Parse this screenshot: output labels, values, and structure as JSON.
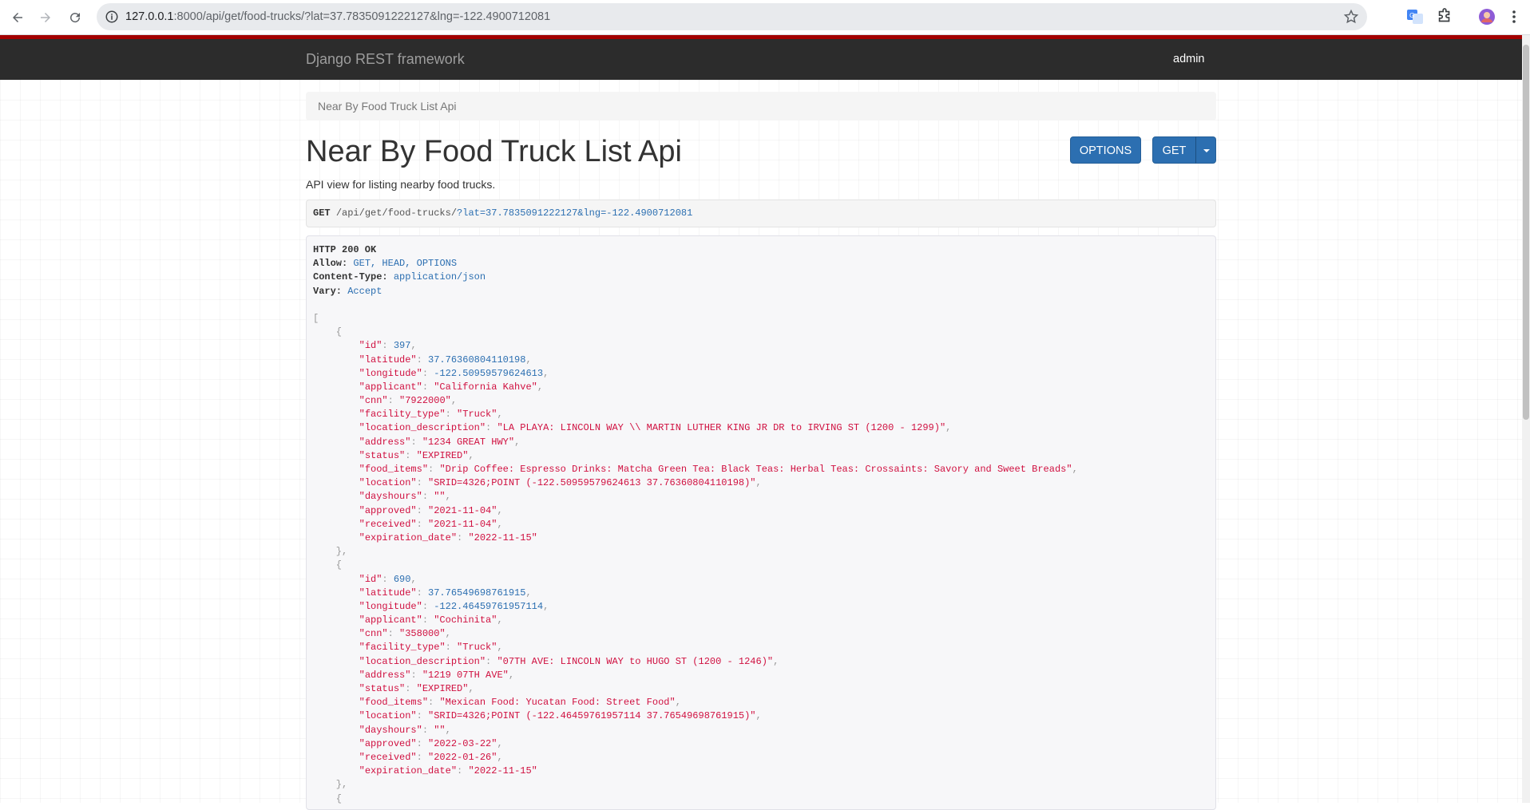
{
  "browser": {
    "url_host": "127.0.0.1",
    "url_rest": ":8000/api/get/food-trucks/?lat=37.7835091222127&lng=-122.4900712081"
  },
  "navbar": {
    "brand": "Django REST framework",
    "user": "admin"
  },
  "breadcrumb": "Near By Food Truck List Api",
  "page": {
    "title": "Near By Food Truck List Api",
    "description": "API view for listing nearby food trucks.",
    "options_label": "OPTIONS",
    "get_label": "GET"
  },
  "request": {
    "method": "GET",
    "path": "/api/get/food-trucks/",
    "query": "?lat=37.7835091222127&lng=-122.4900712081"
  },
  "response": {
    "status": "HTTP 200 OK",
    "headers": [
      {
        "key": "Allow:",
        "value": "GET, HEAD, OPTIONS"
      },
      {
        "key": "Content-Type:",
        "value": "application/json"
      },
      {
        "key": "Vary:",
        "value": "Accept"
      }
    ],
    "records": [
      [
        {
          "k": "id",
          "v": "397",
          "t": "num"
        },
        {
          "k": "latitude",
          "v": "37.76360804110198",
          "t": "num"
        },
        {
          "k": "longitude",
          "v": "-122.50959579624613",
          "t": "num"
        },
        {
          "k": "applicant",
          "v": "\"California Kahve\"",
          "t": "str"
        },
        {
          "k": "cnn",
          "v": "\"7922000\"",
          "t": "str"
        },
        {
          "k": "facility_type",
          "v": "\"Truck\"",
          "t": "str"
        },
        {
          "k": "location_description",
          "v": "\"LA PLAYA: LINCOLN WAY \\\\ MARTIN LUTHER KING JR DR to IRVING ST (1200 - 1299)\"",
          "t": "str"
        },
        {
          "k": "address",
          "v": "\"1234 GREAT HWY\"",
          "t": "str"
        },
        {
          "k": "status",
          "v": "\"EXPIRED\"",
          "t": "str"
        },
        {
          "k": "food_items",
          "v": "\"Drip Coffee: Espresso Drinks: Matcha Green Tea: Black Teas: Herbal Teas: Crossaints: Savory and Sweet Breads\"",
          "t": "str"
        },
        {
          "k": "location",
          "v": "\"SRID=4326;POINT (-122.50959579624613 37.76360804110198)\"",
          "t": "str"
        },
        {
          "k": "dayshours",
          "v": "\"\"",
          "t": "str"
        },
        {
          "k": "approved",
          "v": "\"2021-11-04\"",
          "t": "str"
        },
        {
          "k": "received",
          "v": "\"2021-11-04\"",
          "t": "str"
        },
        {
          "k": "expiration_date",
          "v": "\"2022-11-15\"",
          "t": "str"
        }
      ],
      [
        {
          "k": "id",
          "v": "690",
          "t": "num"
        },
        {
          "k": "latitude",
          "v": "37.76549698761915",
          "t": "num"
        },
        {
          "k": "longitude",
          "v": "-122.46459761957114",
          "t": "num"
        },
        {
          "k": "applicant",
          "v": "\"Cochinita\"",
          "t": "str"
        },
        {
          "k": "cnn",
          "v": "\"358000\"",
          "t": "str"
        },
        {
          "k": "facility_type",
          "v": "\"Truck\"",
          "t": "str"
        },
        {
          "k": "location_description",
          "v": "\"07TH AVE: LINCOLN WAY to HUGO ST (1200 - 1246)\"",
          "t": "str"
        },
        {
          "k": "address",
          "v": "\"1219 07TH AVE\"",
          "t": "str"
        },
        {
          "k": "status",
          "v": "\"EXPIRED\"",
          "t": "str"
        },
        {
          "k": "food_items",
          "v": "\"Mexican Food: Yucatan Food: Street Food\"",
          "t": "str"
        },
        {
          "k": "location",
          "v": "\"SRID=4326;POINT (-122.46459761957114 37.76549698761915)\"",
          "t": "str"
        },
        {
          "k": "dayshours",
          "v": "\"\"",
          "t": "str"
        },
        {
          "k": "approved",
          "v": "\"2022-03-22\"",
          "t": "str"
        },
        {
          "k": "received",
          "v": "\"2022-01-26\"",
          "t": "str"
        },
        {
          "k": "expiration_date",
          "v": "\"2022-11-15\"",
          "t": "str"
        }
      ],
      []
    ]
  }
}
